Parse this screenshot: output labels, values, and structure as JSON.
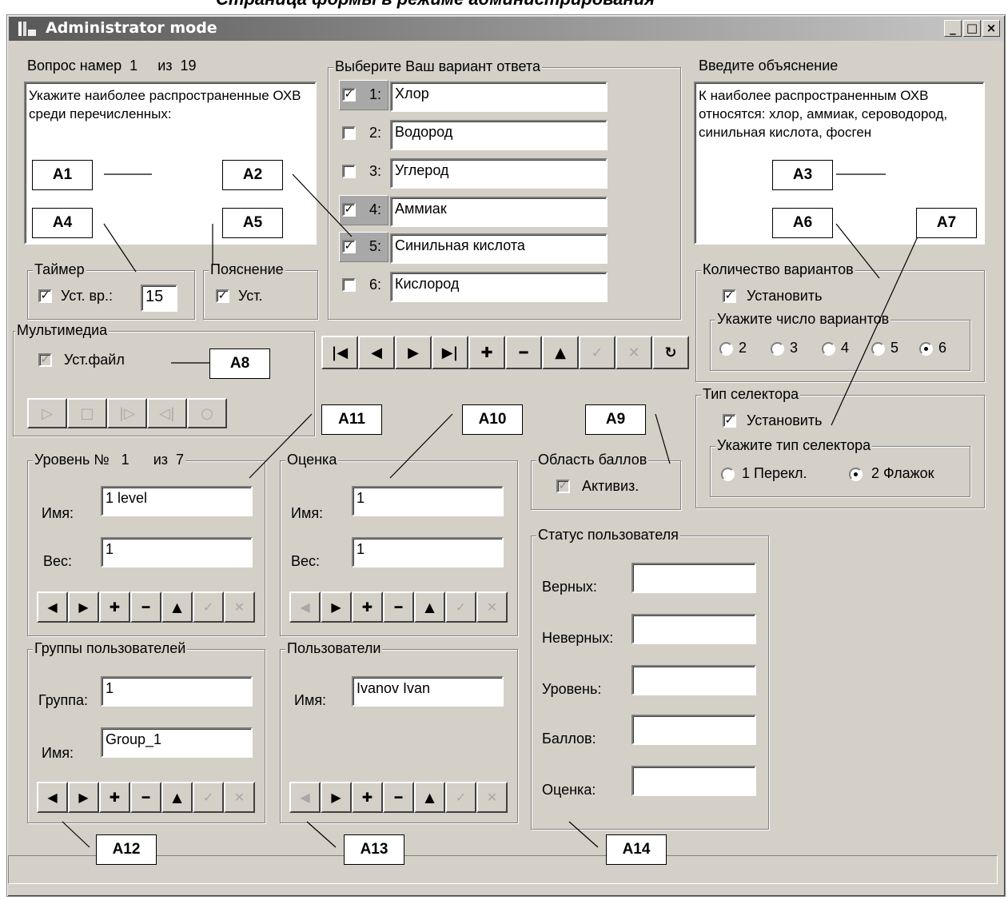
{
  "header": {
    "cut_text": "Страница формы в режиме администрирования"
  },
  "window": {
    "title": "Administrator mode",
    "btn_min": "_",
    "btn_max": "□",
    "btn_close": "×"
  },
  "question": {
    "label": "Вопрос намер",
    "number": "1",
    "of_label": "из",
    "total": "19",
    "text": "Укажите наиболее распространенные ОХВ среди перечисленных:"
  },
  "answers": {
    "legend": "Выберите Ваш вариант ответа",
    "items": [
      {
        "num": "1:",
        "text": "Хлор",
        "checked": true
      },
      {
        "num": "2:",
        "text": "Водород",
        "checked": false
      },
      {
        "num": "3:",
        "text": "Углерод",
        "checked": false
      },
      {
        "num": "4:",
        "text": "Аммиак",
        "checked": true
      },
      {
        "num": "5:",
        "text": "Синильная кислота",
        "checked": true
      },
      {
        "num": "6:",
        "text": "Кислород",
        "checked": false
      }
    ]
  },
  "explanation": {
    "label": "Введите объяснение",
    "text": "К наиболее распространенным ОХВ относятся: хлор, аммиак, сероводород, синильная кислота, фосген"
  },
  "timer": {
    "legend": "Таймер",
    "check_label": "Уст. вр.:",
    "value": "15"
  },
  "hint": {
    "legend": "Пояснение",
    "check_label": "Уст."
  },
  "multimedia": {
    "legend": "Мультимедиа",
    "check_label": "Уст.файл"
  },
  "variants_count": {
    "legend": "Количество вариантов",
    "check_label": "Установить",
    "sub_legend": "Укажите число вариантов",
    "options": [
      "2",
      "3",
      "4",
      "5",
      "6"
    ],
    "selected": "6"
  },
  "selector_type": {
    "legend": "Тип селектора",
    "check_label": "Установить",
    "sub_legend": "Укажите тип селектора",
    "options": [
      "1 Перекл.",
      "2 Флажок"
    ],
    "selected": "2 Флажок"
  },
  "score_area": {
    "legend": "Область баллов",
    "check_label": "Активиз."
  },
  "level": {
    "legend": "Уровень №",
    "number": "1",
    "of_label": "из",
    "total": "7",
    "name_label": "Имя:",
    "name_value": "1 level",
    "weight_label": "Вес:",
    "weight_value": "1"
  },
  "grade": {
    "legend": "Оценка",
    "name_label": "Имя:",
    "name_value": "1",
    "weight_label": "Вес:",
    "weight_value": "1"
  },
  "user_groups": {
    "legend": "Группы пользователей",
    "group_label": "Группа:",
    "group_value": "1",
    "name_label": "Имя:",
    "name_value": "Group_1"
  },
  "users": {
    "legend": "Пользователи",
    "name_label": "Имя:",
    "name_value": "Ivanov Ivan"
  },
  "user_status": {
    "legend": "Статус пользователя",
    "fields": [
      "Верных:",
      "Неверных:",
      "Уровень:",
      "Баллов:",
      "Оценка:"
    ]
  },
  "callouts": [
    "A1",
    "A2",
    "A3",
    "A4",
    "A5",
    "A6",
    "A7",
    "A8",
    "A9",
    "A10",
    "A11",
    "A12",
    "A13",
    "A14"
  ]
}
